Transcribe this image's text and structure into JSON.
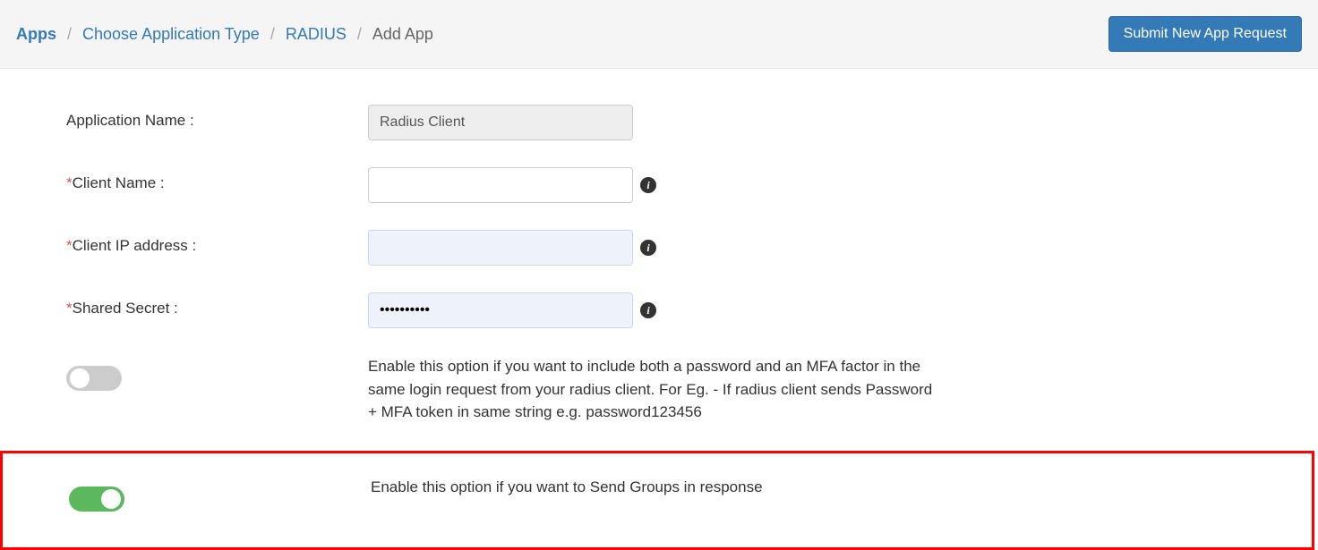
{
  "breadcrumb": {
    "apps": "Apps",
    "choose": "Choose Application Type",
    "radius": "RADIUS",
    "current": "Add App"
  },
  "header": {
    "submit_label": "Submit New App Request"
  },
  "form": {
    "app_name_label": "Application Name :",
    "app_name_value": "Radius Client",
    "client_name_label": "Client Name :",
    "client_name_value": "",
    "client_ip_label": "Client IP address :",
    "client_ip_value": "",
    "shared_secret_label": "Shared Secret :",
    "shared_secret_value": "••••••••••",
    "toggle1_desc": "Enable this option if you want to include both a password and an MFA factor in the same login request from your radius client. For Eg. - If radius client sends Password + MFA token in same string e.g. password123456",
    "toggle2_desc": "Enable this option if you want to Send Groups in response"
  },
  "icons": {
    "info": "i"
  }
}
